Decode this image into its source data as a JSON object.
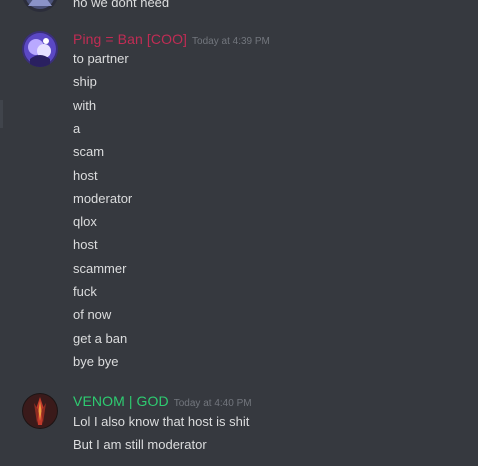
{
  "top_partial": {
    "text": "no we dont need"
  },
  "messages": [
    {
      "username": "Ping = Ban [COO]",
      "username_color": "#c12c54",
      "timestamp": "Today at 4:39 PM",
      "lines": [
        "to partner",
        "ship",
        "with",
        "a",
        "scam",
        "host",
        "moderator",
        "qlox",
        "host",
        "scammer",
        "fuck",
        "of now",
        "get a ban",
        "bye bye"
      ]
    },
    {
      "username": "VENOM | GOD",
      "username_color": "#2ecc71",
      "timestamp": "Today at 4:40 PM",
      "lines": [
        "Lol I also know that host is shit",
        "But I am still moderator"
      ]
    }
  ],
  "colors": {
    "background": "#36393f",
    "text": "#dcddde",
    "timestamp": "#72767d"
  }
}
